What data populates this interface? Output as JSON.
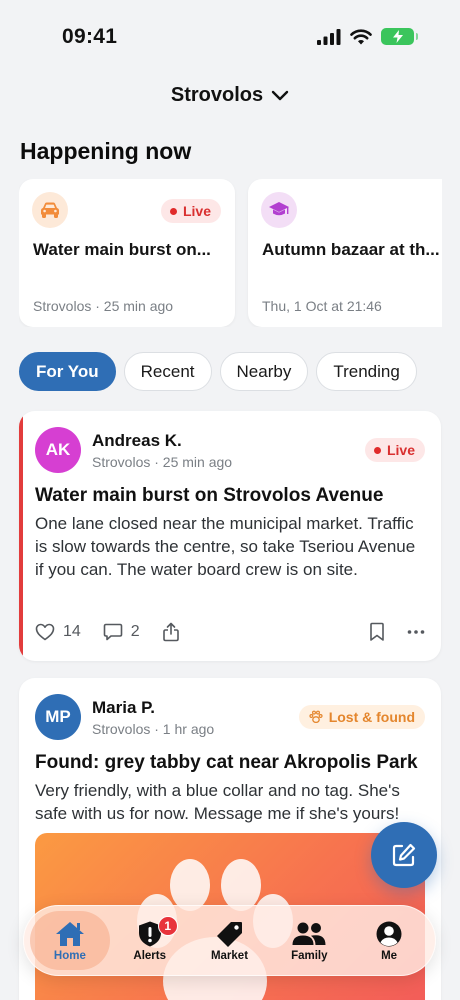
{
  "status_bar": {
    "time": "09:41"
  },
  "location": {
    "name": "Strovolos"
  },
  "happening_now": {
    "title": "Happening now",
    "cards": [
      {
        "icon": "car-icon",
        "title": "Water main burst on...",
        "meta": "Strovolos · 25 min ago",
        "badge": "Live"
      },
      {
        "icon": "graduation-cap-icon",
        "title": "Autumn bazaar at th...",
        "meta": "Thu, 1 Oct at 21:46"
      }
    ]
  },
  "filters": [
    "For You",
    "Recent",
    "Nearby",
    "Trending"
  ],
  "active_filter": "For You",
  "posts": [
    {
      "initials": "AK",
      "author": "Andreas K.",
      "meta": "Strovolos · 25 min ago",
      "badge": "Live",
      "title": "Water main burst on Strovolos Avenue",
      "body": "One lane closed near the municipal market. Traffic is slow towards the centre, so take Tseriou Avenue if you can. The water board crew is on site.",
      "likes": "14",
      "comments": "2"
    },
    {
      "initials": "MP",
      "author": "Maria P.",
      "meta": "Strovolos · 1 hr ago",
      "badge": "Lost & found",
      "title": "Found: grey tabby cat near Akropolis Park",
      "body": "Very friendly, with a blue collar and no tag. She's safe with us for now. Message me if she's yours!"
    }
  ],
  "tabbar": {
    "tabs": [
      {
        "label": "Home",
        "icon": "home-icon",
        "active": true
      },
      {
        "label": "Alerts",
        "icon": "alert-shield-icon",
        "badge": "1"
      },
      {
        "label": "Market",
        "icon": "tag-icon"
      },
      {
        "label": "Family",
        "icon": "people-icon"
      },
      {
        "label": "Me",
        "icon": "person-circle-icon"
      }
    ]
  },
  "colors": {
    "accent": "#2f6eb5",
    "live": "#e02b2b",
    "lost_found": "#e4862d",
    "avatar_ak": "#d63fd2",
    "avatar_mp": "#2f6eb5"
  }
}
